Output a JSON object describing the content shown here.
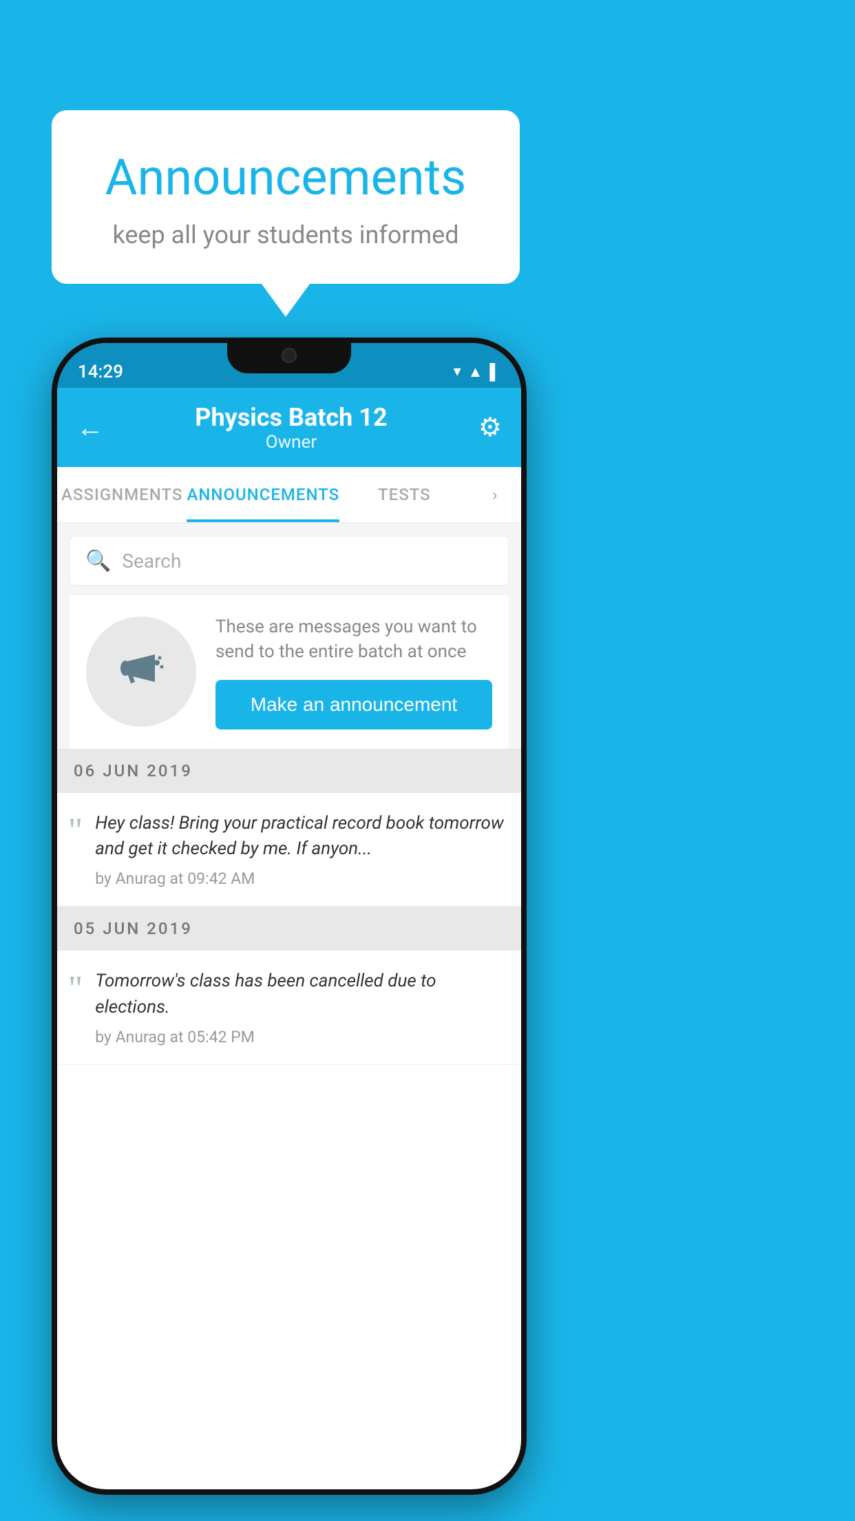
{
  "background_color": "#1ab5e8",
  "speech_bubble": {
    "title": "Announcements",
    "subtitle": "keep all your students informed"
  },
  "status_bar": {
    "time": "14:29",
    "icons": [
      "▼",
      "▲",
      "▌"
    ]
  },
  "header": {
    "back_label": "←",
    "title": "Physics Batch 12",
    "subtitle": "Owner",
    "gear_label": "⚙"
  },
  "tabs": [
    {
      "label": "ASSIGNMENTS",
      "active": false
    },
    {
      "label": "ANNOUNCEMENTS",
      "active": true
    },
    {
      "label": "TESTS",
      "active": false
    },
    {
      "label": "›",
      "active": false
    }
  ],
  "search": {
    "placeholder": "Search"
  },
  "empty_state": {
    "description": "These are messages you want to\nsend to the entire batch at once",
    "button_label": "Make an announcement"
  },
  "announcements": [
    {
      "date": "06  JUN  2019",
      "message": "Hey class! Bring your practical record book tomorrow and get it checked by me. If anyon...",
      "meta": "by Anurag at 09:42 AM"
    },
    {
      "date": "05  JUN  2019",
      "message": "Tomorrow's class has been cancelled due to elections.",
      "meta": "by Anurag at 05:42 PM"
    }
  ]
}
